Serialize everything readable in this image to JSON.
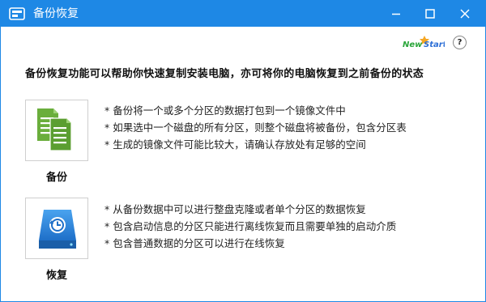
{
  "window": {
    "title": "备份恢复",
    "colors": {
      "titlebar": "#1e88e5",
      "backup_icon": "#6aae3c",
      "restore_icon": "#1e88e5"
    }
  },
  "brand": {
    "logo_part1": "New",
    "logo_part2": "Start",
    "help_label": "?"
  },
  "headline": "备份恢复功能可以帮助你快速复制安装电脑，亦可将你的电脑恢复到之前备份的状态",
  "backup": {
    "label": "备份",
    "icon": "document-copy-icon",
    "bullet": "*",
    "descriptions": [
      "备份将一个或多个分区的数据打包到一个镜像文件中",
      "如果选中一个磁盘的所有分区，则整个磁盘将被备份，包含分区表",
      "生成的镜像文件可能比较大，请确认存放处有足够的空间"
    ]
  },
  "restore": {
    "label": "恢复",
    "icon": "disk-restore-icon",
    "bullet": "*",
    "descriptions": [
      "从备份数据中可以进行整盘克隆或者单个分区的数据恢复",
      "包含启动信息的分区只能进行离线恢复而且需要单独的启动介质",
      "包含普通数据的分区可以进行在线恢复"
    ]
  }
}
